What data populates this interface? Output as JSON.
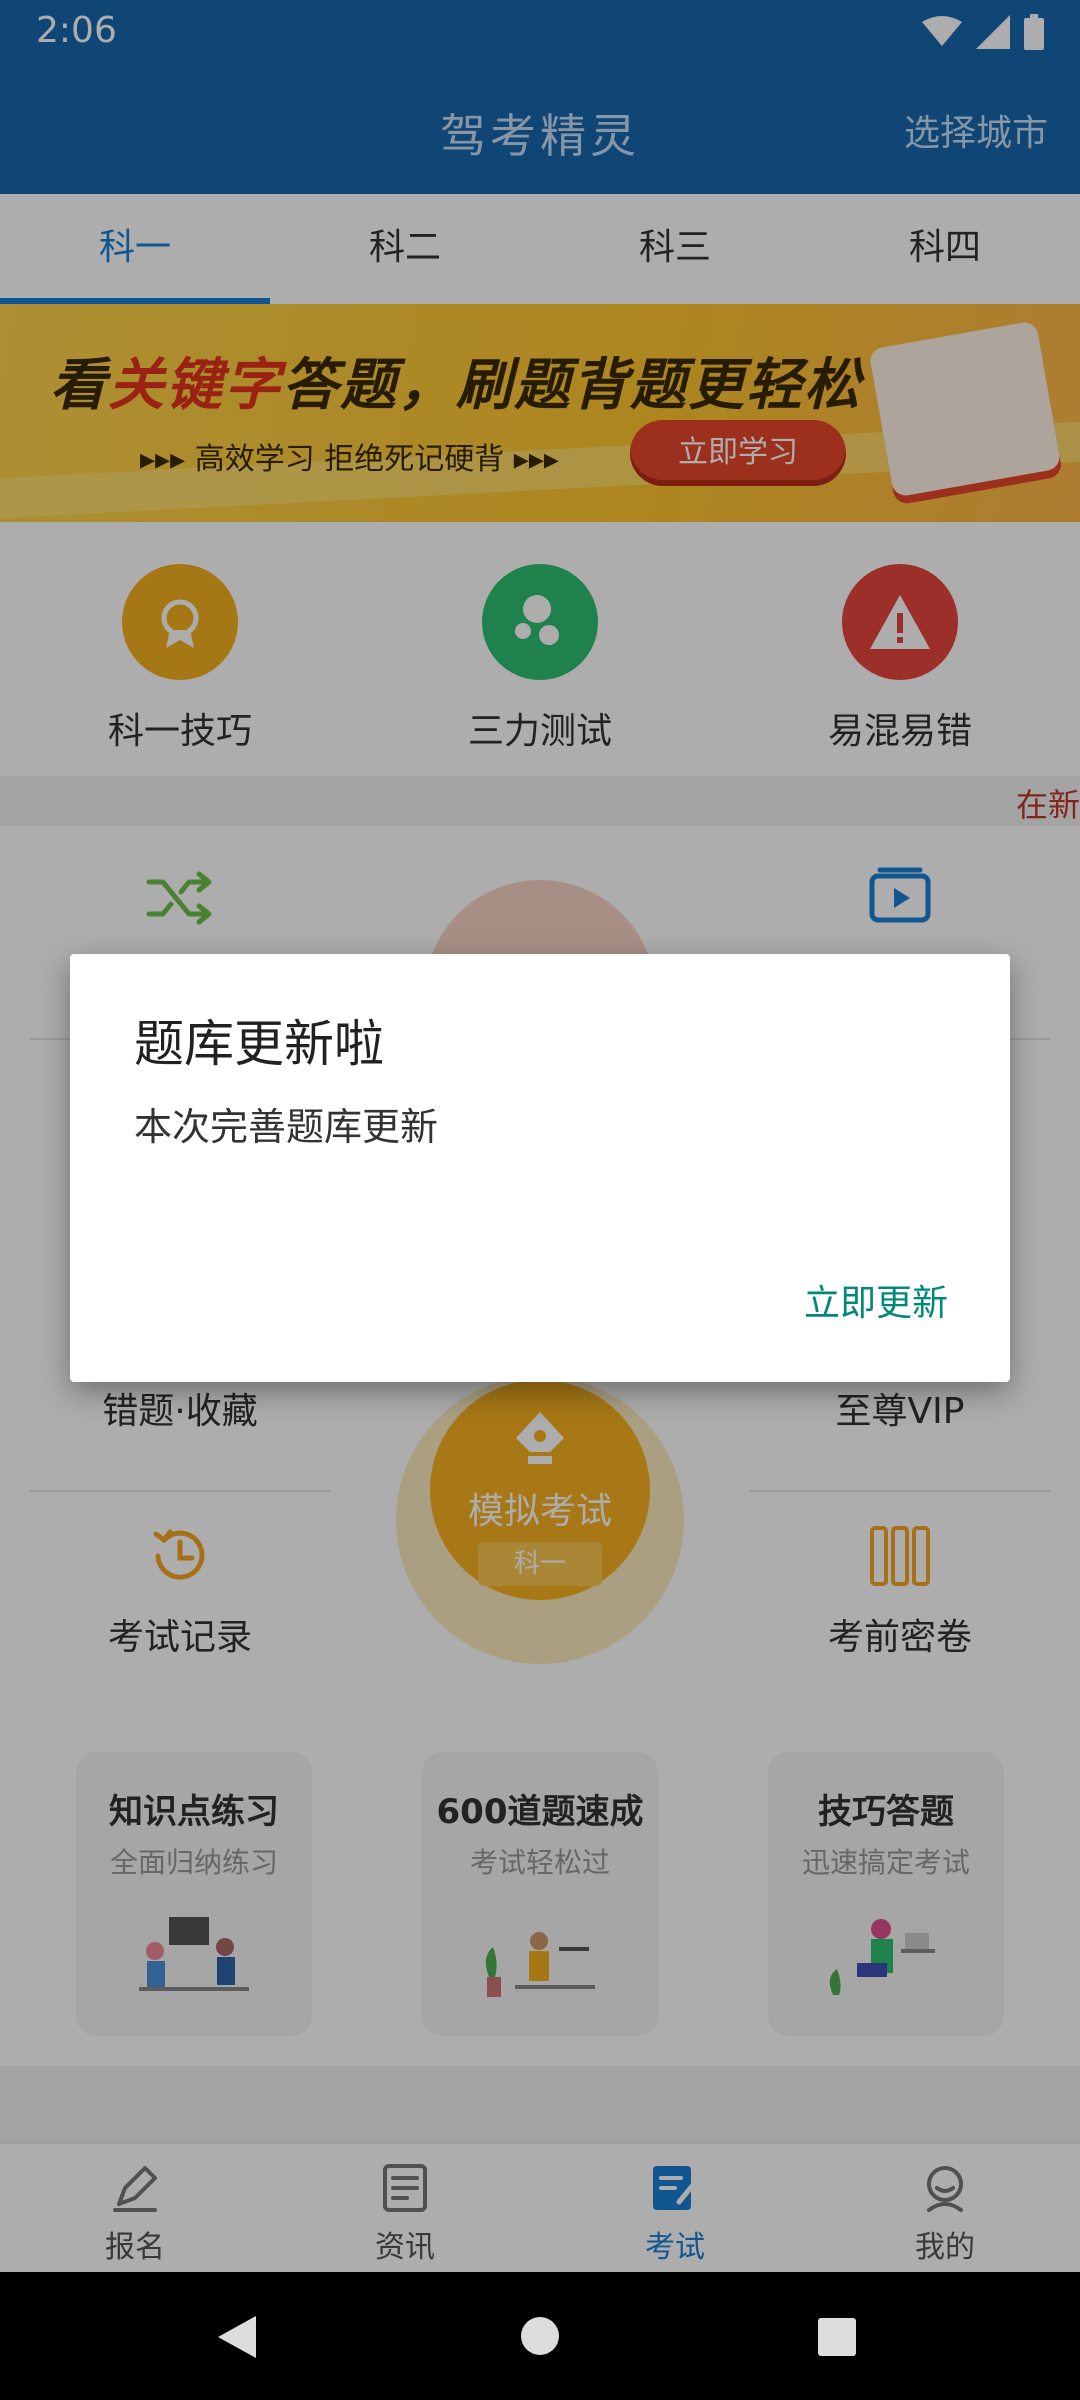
{
  "status_bar": {
    "time": "2:06"
  },
  "app_bar": {
    "title": "驾考精灵",
    "city_button": "选择城市"
  },
  "tabs": [
    {
      "label": "科一",
      "active": true
    },
    {
      "label": "科二",
      "active": false
    },
    {
      "label": "科三",
      "active": false
    },
    {
      "label": "科四",
      "active": false
    }
  ],
  "banner": {
    "title_part1": "看",
    "title_highlight": "关键字",
    "title_part2": "答题，刷题背题更轻松",
    "subtitle": "▸▸▸  高效学习  拒绝死记硬背  ▸▸▸",
    "cta": "立即学习"
  },
  "quick_actions": [
    {
      "label": "科一技巧",
      "icon": "medal-icon",
      "color": "#f5b21f"
    },
    {
      "label": "三力测试",
      "icon": "bubbles-icon",
      "color": "#2fbf71"
    },
    {
      "label": "易混易错",
      "icon": "warning-icon",
      "color": "#e8463e"
    }
  ],
  "marquee": {
    "text": "在新"
  },
  "functions": {
    "top_left_icon": "shuffle-icon",
    "top_right_icon": "video-icon",
    "mid_left": "错题·收藏",
    "mid_right": "至尊VIP",
    "bottom_left": "考试记录",
    "bottom_right": "考前密卷",
    "center_title": "模拟考试",
    "center_sub": "科一"
  },
  "cards": [
    {
      "title": "知识点练习",
      "subtitle": "全面归纳练习"
    },
    {
      "title": "600道题速成",
      "subtitle": "考试轻松过"
    },
    {
      "title": "技巧答题",
      "subtitle": "迅速搞定考试"
    }
  ],
  "bottom_nav": [
    {
      "label": "报名",
      "icon": "pen-icon",
      "active": false
    },
    {
      "label": "资讯",
      "icon": "news-icon",
      "active": false
    },
    {
      "label": "考试",
      "icon": "exam-icon",
      "active": true
    },
    {
      "label": "我的",
      "icon": "profile-icon",
      "active": false
    }
  ],
  "dialog": {
    "title": "题库更新啦",
    "message": "本次完善题库更新",
    "confirm": "立即更新"
  },
  "colors": {
    "primary": "#1767ae",
    "tab_active": "#1a7fd6",
    "dialog_button": "#00897b",
    "exam_orange": "#f7b21f"
  }
}
